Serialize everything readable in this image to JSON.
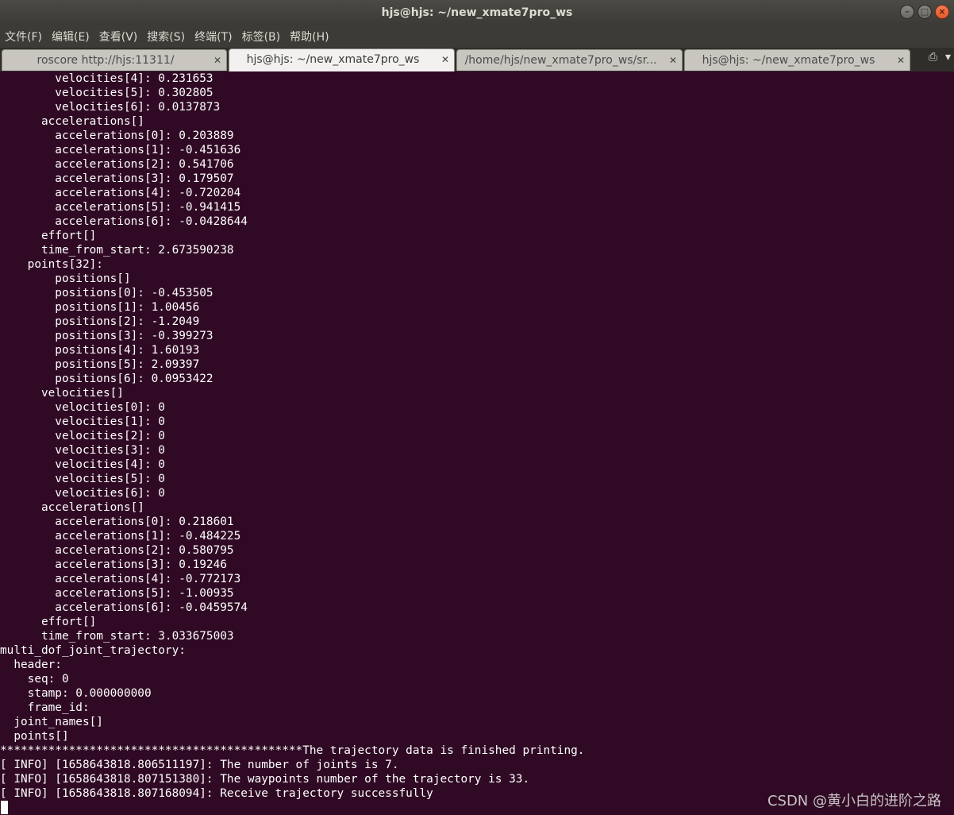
{
  "window": {
    "title": "hjs@hjs: ~/new_xmate7pro_ws"
  },
  "menu": [
    "文件(F)",
    "编辑(E)",
    "查看(V)",
    "搜索(S)",
    "终端(T)",
    "标签(B)",
    "帮助(H)"
  ],
  "tabs": [
    {
      "label": "roscore http://hjs:11311/"
    },
    {
      "label": "hjs@hjs: ~/new_xmate7pro_ws"
    },
    {
      "label": "/home/hjs/new_xmate7pro_ws/sr..."
    },
    {
      "label": "hjs@hjs: ~/new_xmate7pro_ws"
    }
  ],
  "terminal": {
    "lines": [
      "        velocities[4]: 0.231653",
      "        velocities[5]: 0.302805",
      "        velocities[6]: 0.0137873",
      "      accelerations[]",
      "        accelerations[0]: 0.203889",
      "        accelerations[1]: -0.451636",
      "        accelerations[2]: 0.541706",
      "        accelerations[3]: 0.179507",
      "        accelerations[4]: -0.720204",
      "        accelerations[5]: -0.941415",
      "        accelerations[6]: -0.0428644",
      "      effort[]",
      "      time_from_start: 2.673590238",
      "    points[32]:",
      "        positions[]",
      "        positions[0]: -0.453505",
      "        positions[1]: 1.00456",
      "        positions[2]: -1.2049",
      "        positions[3]: -0.399273",
      "        positions[4]: 1.60193",
      "        positions[5]: 2.09397",
      "        positions[6]: 0.0953422",
      "      velocities[]",
      "        velocities[0]: 0",
      "        velocities[1]: 0",
      "        velocities[2]: 0",
      "        velocities[3]: 0",
      "        velocities[4]: 0",
      "        velocities[5]: 0",
      "        velocities[6]: 0",
      "      accelerations[]",
      "        accelerations[0]: 0.218601",
      "        accelerations[1]: -0.484225",
      "        accelerations[2]: 0.580795",
      "        accelerations[3]: 0.19246",
      "        accelerations[4]: -0.772173",
      "        accelerations[5]: -1.00935",
      "        accelerations[6]: -0.0459574",
      "      effort[]",
      "      time_from_start: 3.033675003",
      "multi_dof_joint_trajectory:",
      "  header:",
      "    seq: 0",
      "    stamp: 0.000000000",
      "    frame_id:",
      "  joint_names[]",
      "  points[]",
      "********************************************The trajectory data is finished printing.",
      "[ INFO] [1658643818.806511197]: The number of joints is 7.",
      "[ INFO] [1658643818.807151380]: The waypoints number of the trajectory is 33.",
      "[ INFO] [1658643818.807168094]: Receive trajectory successfully"
    ]
  },
  "watermark": "CSDN @黄小白的进阶之路"
}
